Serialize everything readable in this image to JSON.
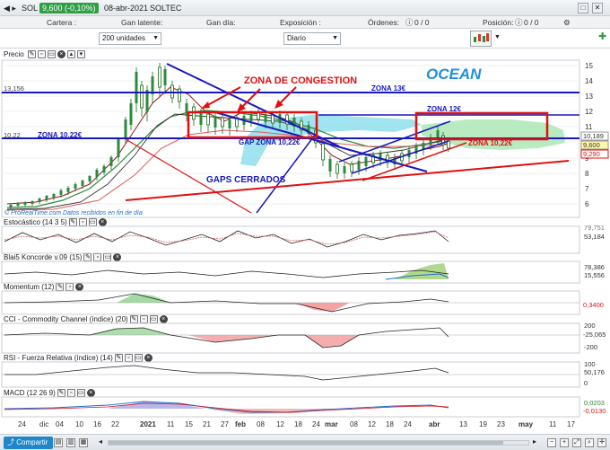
{
  "title": {
    "nav_label": "SOL",
    "change_badge": "9,600 (-0,10%)",
    "date": "08-abr-2021",
    "symbol": "SOLTEC"
  },
  "infobar": {
    "cartera": "Cartera :",
    "gan_latente": "Gan latente:",
    "gan_dia": "Gan día:",
    "exposicion": "Exposición :",
    "ordenes": "Órdenes:",
    "ordenes_val": "0 / 0",
    "posicion": "Posición:",
    "posicion_val": "0 / 0"
  },
  "toolbar": {
    "units_select": "200 unidades",
    "period_select": "Diario"
  },
  "price_panel": {
    "label": "Precio",
    "y_ticks": [
      "15",
      "14",
      "13",
      "12",
      "11",
      "10",
      "9",
      "8",
      "7",
      "6"
    ],
    "left_level_1": "13,156",
    "left_level_2": "10,22",
    "last_values": [
      "10,189",
      "9,600",
      "9,290"
    ],
    "watermark": "© ProRealTime.com  Datos recibidos en fin de día",
    "annotations": {
      "ocean": "OCEAN",
      "zona_congestion": "ZONA DE CONGESTION",
      "zona_13": "ZONA 13€",
      "zona_12": "ZONA 12€",
      "zona_1022_left": "ZONA 10,22€",
      "zona_1022_right": "ZONA 10,22€",
      "gap_zona": "GAP ZONA 10,22€",
      "gaps_cerrados": "GAPS CERRADOS"
    }
  },
  "indicators": [
    {
      "label": "Estocástico (14 3 5)",
      "values": [
        "79,751",
        "53,184"
      ]
    },
    {
      "label": "Blai5 Koncorde v.09 (15)",
      "values": [
        "78,386",
        "15,556"
      ]
    },
    {
      "label": "Momentum (12)",
      "values": [
        "0,3400"
      ]
    },
    {
      "label": "CCI - Commodity Channel (índice) (20)",
      "values": [
        "200",
        "-25,065",
        "-200"
      ]
    },
    {
      "label": "RSI - Fuerza Relativa (índice) (14)",
      "values": [
        "100",
        "50,176",
        "0"
      ]
    },
    {
      "label": "MACD (12 26 9)",
      "values": [
        "0,0203",
        "-0,0130"
      ]
    }
  ],
  "x_axis": [
    "24",
    "dic",
    "04",
    "10",
    "16",
    "22",
    "2021",
    "11",
    "15",
    "21",
    "27",
    "feb",
    "08",
    "12",
    "18",
    "24",
    "mar",
    "08",
    "12",
    "18",
    "24",
    "abr",
    "13",
    "19",
    "23",
    "may",
    "11",
    "17"
  ],
  "status": {
    "share_button": "Compartir"
  },
  "colors": {
    "annotation_red": "#e01010",
    "annotation_blue": "#1818c0",
    "ocean_blue": "#1f8fe0",
    "cloud_cyan": "#6fd6e6",
    "cloud_green": "#a8e6b0"
  }
}
